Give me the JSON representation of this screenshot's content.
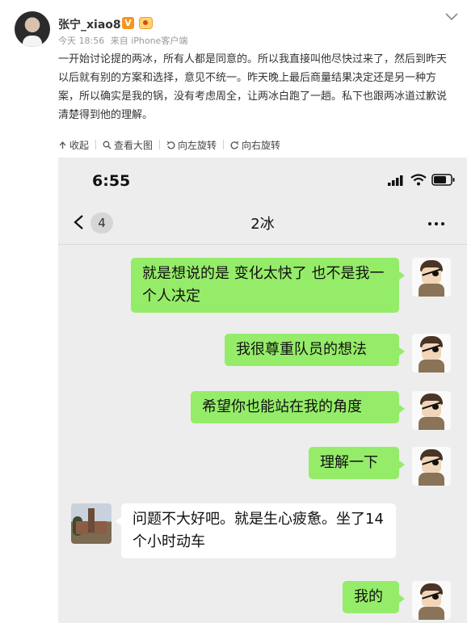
{
  "post": {
    "username": "张宁_xiao8",
    "verified_badge": "V",
    "time": "今天 18:56",
    "source": "来自 iPhone客户端",
    "text": "一开始讨论提的两冰，所有人都是同意的。所以我直接叫他尽快过来了，然后到昨天以后就有别的方案和选择，意见不统一。昨天晚上最后商量结果决定还是另一种方案，所以确实是我的锅，没有考虑周全，让两冰白跑了一趟。私下也跟两冰道过歉说清楚得到他的理解。"
  },
  "toolbar": {
    "collapse": "收起",
    "view_large": "查看大图",
    "rotate_left": "向左旋转",
    "rotate_right": "向右旋转"
  },
  "phone": {
    "time": "6:55",
    "unread_count": "4",
    "chat_title": "2冰"
  },
  "messages": [
    {
      "sender": "me",
      "text": "就是想说的是 变化太快了 也不是我一个人决定"
    },
    {
      "sender": "me",
      "text": "我很尊重队员的想法"
    },
    {
      "sender": "me",
      "text": "希望你也能站在我的角度"
    },
    {
      "sender": "me",
      "text": "理解一下"
    },
    {
      "sender": "other",
      "text": "问题不大好吧。就是生心疲惫。坐了14个小时动车"
    },
    {
      "sender": "me",
      "text": "我的"
    }
  ],
  "colors": {
    "my_bubble": "#95ec69",
    "other_bubble": "#ffffff",
    "chat_bg": "#ededed",
    "verified": "#f7941d"
  },
  "icons": [
    "chevron-down-icon",
    "collapse-icon",
    "search-icon",
    "rotate-left-icon",
    "rotate-right-icon",
    "signal-icon",
    "wifi-icon",
    "battery-icon",
    "back-arrow-icon",
    "more-icon"
  ]
}
